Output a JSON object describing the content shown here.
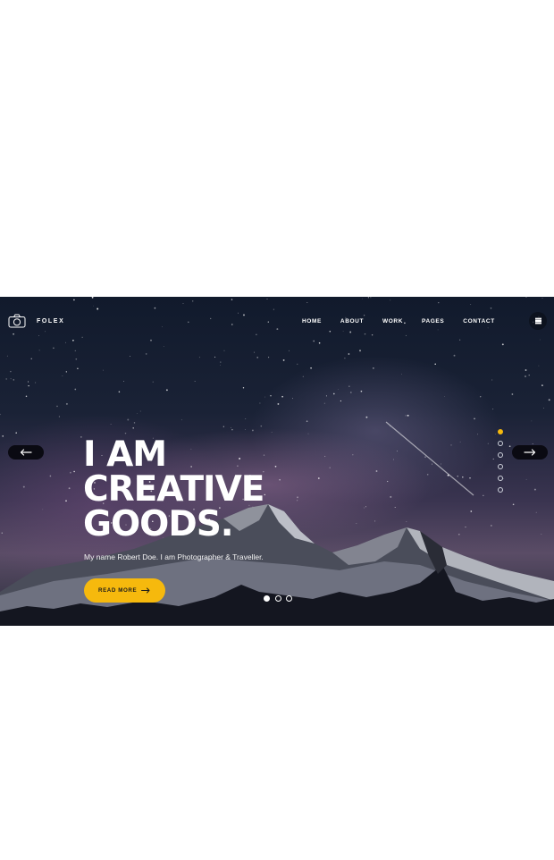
{
  "brand": {
    "name": "FOLEX",
    "logo_icon": "camera-icon"
  },
  "nav": {
    "items": [
      "HOME",
      "ABOUT",
      "WORK",
      "PAGES",
      "CONTACT"
    ]
  },
  "menu_icon": "hamburger-icon",
  "hero": {
    "headline": [
      "I AM",
      "CREATIVE",
      "GOODS."
    ],
    "subtitle": "My name Robert Doe. I am Photographer & Traveller.",
    "cta_label": "READ MORE",
    "cta_icon": "arrow-right-icon",
    "prev_icon": "arrow-left-icon",
    "next_icon": "arrow-right-icon"
  },
  "slider": {
    "vertical_dots": 6,
    "vertical_active": 0,
    "horizontal_dots": 3,
    "horizontal_active": 0
  },
  "colors": {
    "accent": "#f6b90d",
    "dark": "#0a0a12",
    "text": "#ffffff"
  }
}
